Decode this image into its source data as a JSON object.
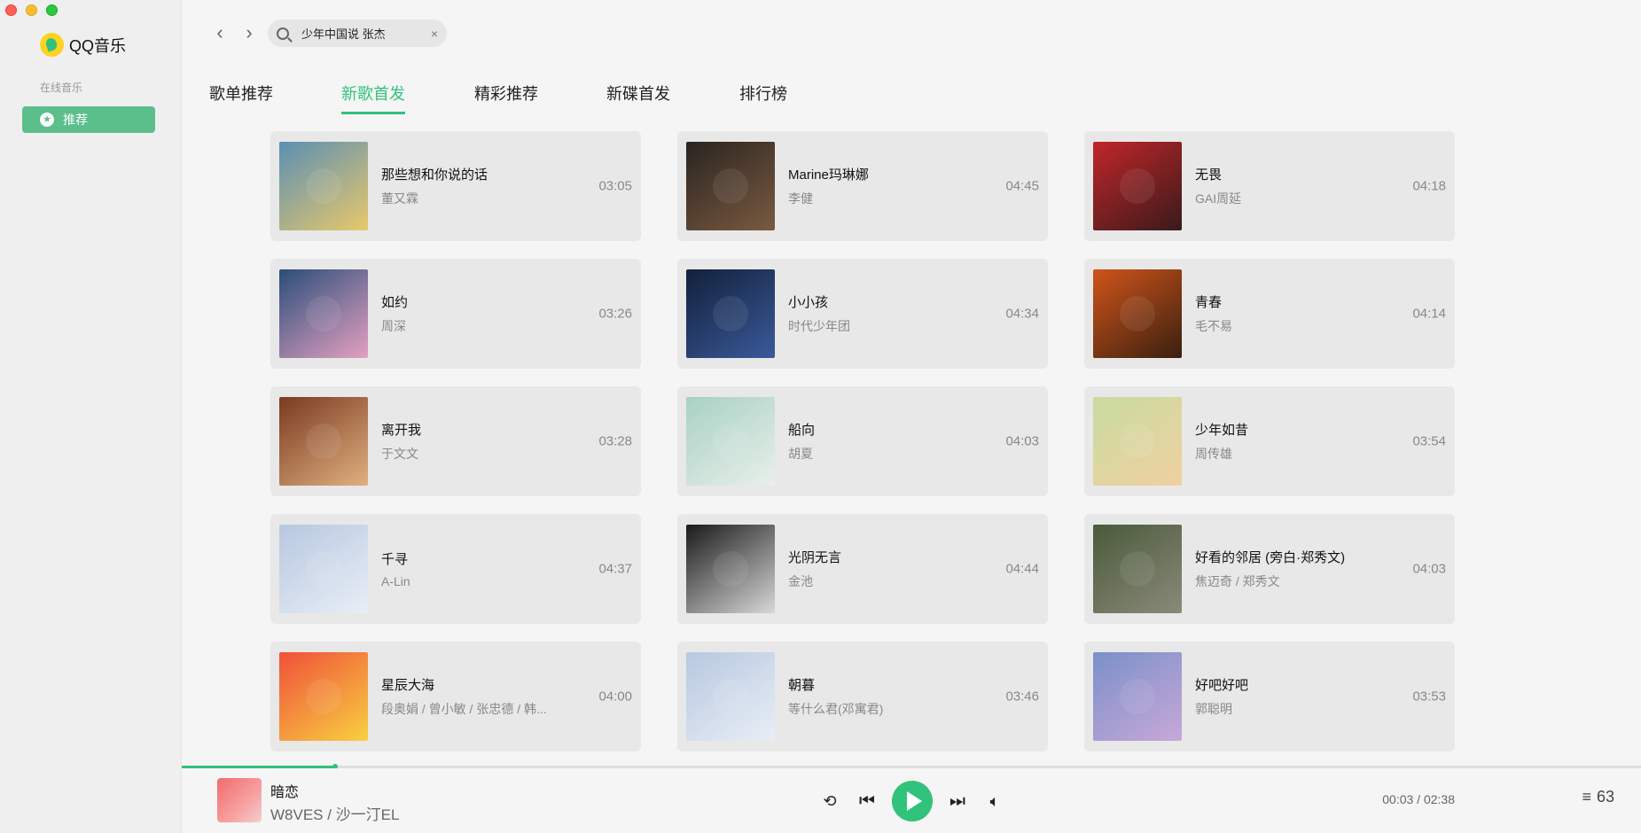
{
  "app": {
    "name": "QQ音乐"
  },
  "sidebar": {
    "section_label": "在线音乐",
    "items": [
      {
        "label": "推荐",
        "icon": "star-icon",
        "active": true
      }
    ]
  },
  "search": {
    "value": "少年中国说 张杰",
    "placeholder": ""
  },
  "tabs": [
    {
      "label": "歌单推荐",
      "active": false
    },
    {
      "label": "新歌首发",
      "active": true
    },
    {
      "label": "精彩推荐",
      "active": false
    },
    {
      "label": "新碟首发",
      "active": false
    },
    {
      "label": "排行榜",
      "active": false
    }
  ],
  "songs": [
    {
      "title": "那些想和你说的话",
      "artist": "董又霖",
      "duration": "03:05",
      "cover": [
        "#5b8fb4",
        "#e8c86a"
      ]
    },
    {
      "title": "Marine玛琳娜",
      "artist": "李健",
      "duration": "04:45",
      "cover": [
        "#2a2420",
        "#7a5a40"
      ]
    },
    {
      "title": "无畏",
      "artist": "GAI周延",
      "duration": "04:18",
      "cover": [
        "#c0262a",
        "#3a1a1a"
      ]
    },
    {
      "title": "如约",
      "artist": "周深",
      "duration": "03:26",
      "cover": [
        "#2a4e7a",
        "#e4a0c0"
      ]
    },
    {
      "title": "小小孩",
      "artist": "时代少年团",
      "duration": "04:34",
      "cover": [
        "#12203a",
        "#3a5a9a"
      ]
    },
    {
      "title": "青春",
      "artist": "毛不易",
      "duration": "04:14",
      "cover": [
        "#d0541a",
        "#3a2010"
      ]
    },
    {
      "title": "离开我",
      "artist": "于文文",
      "duration": "03:28",
      "cover": [
        "#7a3a20",
        "#e0b080"
      ]
    },
    {
      "title": "船向",
      "artist": "胡夏",
      "duration": "04:03",
      "cover": [
        "#a8d0c4",
        "#e8f0ea"
      ]
    },
    {
      "title": "少年如昔",
      "artist": "周传雄",
      "duration": "03:54",
      "cover": [
        "#c8dca0",
        "#f0d0a0"
      ]
    },
    {
      "title": "千寻",
      "artist": "A-Lin",
      "duration": "04:37",
      "cover": [
        "#b8c8e0",
        "#e8eef6"
      ]
    },
    {
      "title": "光阴无言",
      "artist": "金池",
      "duration": "04:44",
      "cover": [
        "#1a1a1a",
        "#d8d8d8"
      ]
    },
    {
      "title": "好看的邻居 (旁白·郑秀文)",
      "artist": "焦迈奇 / 郑秀文",
      "duration": "04:03",
      "cover": [
        "#4a5a3a",
        "#8a8a7a"
      ]
    },
    {
      "title": "星辰大海",
      "artist": "段奥娟 / 曾小敏 / 张忠德 / 韩...",
      "duration": "04:00",
      "cover": [
        "#f0503a",
        "#f8d040"
      ]
    },
    {
      "title": "朝暮",
      "artist": "等什么君(邓寓君)",
      "duration": "03:46",
      "cover": [
        "#b8c8e0",
        "#e8eef6"
      ]
    },
    {
      "title": "好吧好吧",
      "artist": "郭聪明",
      "duration": "03:53",
      "cover": [
        "#7a90c8",
        "#c8a8d8"
      ]
    }
  ],
  "player": {
    "title": "暗恋",
    "artist": "W8VES / 沙一汀EL",
    "current_time": "00:03",
    "total_time": "02:38",
    "time_display": "00:03 / 02:38",
    "progress": 0.105,
    "queue_count": "63"
  },
  "colors": {
    "accent": "#31c27c",
    "sidebar_active": "#5bbf8c"
  }
}
